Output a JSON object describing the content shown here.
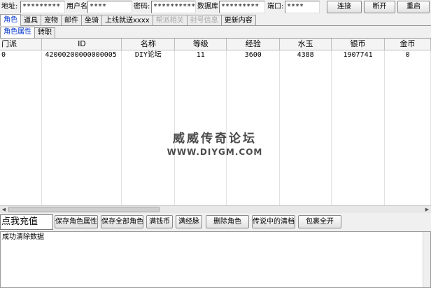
{
  "connection": {
    "address_label": "地址:",
    "address_value": "*********",
    "username_label": "用户名:",
    "username_value": "****",
    "password_label": "密码:",
    "password_value": "**********",
    "database_label": "数据库:",
    "database_value": "*********",
    "port_label": "端口:",
    "port_value": "****",
    "connect_label": "连接",
    "disconnect_label": "断开",
    "restart_label": "重启"
  },
  "tabs": [
    {
      "label": "角色",
      "active": true
    },
    {
      "label": "道具"
    },
    {
      "label": "宠物"
    },
    {
      "label": "邮件"
    },
    {
      "label": "坐骑"
    },
    {
      "label": "上线就送xxxx"
    },
    {
      "label": "帮派相关",
      "disabled": true
    },
    {
      "label": "封号信息",
      "disabled": true
    },
    {
      "label": "更新内容"
    }
  ],
  "subtabs": [
    {
      "label": "角色属性",
      "active": true
    },
    {
      "label": "转职"
    }
  ],
  "grid": {
    "columns": [
      "门派",
      "ID",
      "名称",
      "等级",
      "经验",
      "水玉",
      "银币",
      "金币"
    ],
    "rows": [
      [
        "0",
        "42000200000000005",
        "DIY论坛",
        "11",
        "3600",
        "4388",
        "1907741",
        "0"
      ]
    ]
  },
  "watermark": {
    "title": "威威传奇论坛",
    "url": "WWW.DIYGM.COM"
  },
  "actions": {
    "recharge_label": "点我充值",
    "buttons": [
      "保存角色属性",
      "保存全部角色",
      "满钱币",
      "满经脉",
      "删除角色",
      "传说中的清档",
      "包裹全开"
    ]
  },
  "log": {
    "text": "成功清除数据"
  },
  "colors": {
    "active_tab_text": "#0033cc",
    "disabled_tab_text": "#a8a8a8",
    "window_background": "#f0f0f0"
  }
}
